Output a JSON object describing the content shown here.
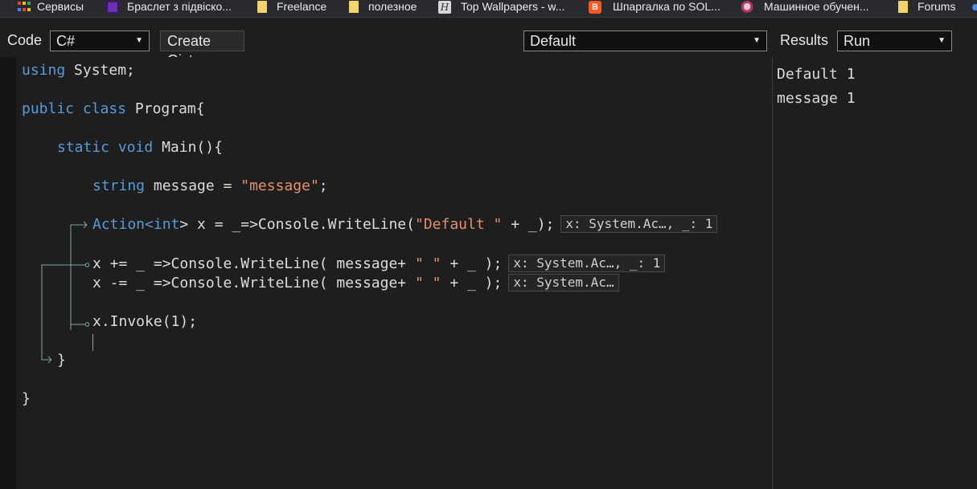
{
  "bookmarks": [
    {
      "label": "Сервисы",
      "icon": "apps-grid-icon"
    },
    {
      "label": "Браслет з підвіско...",
      "icon": "purple-square-icon"
    },
    {
      "label": "Freelance",
      "icon": "folder-icon"
    },
    {
      "label": "полезное",
      "icon": "folder-icon"
    },
    {
      "label": "Top Wallpapers - w...",
      "icon": "script-h-icon"
    },
    {
      "label": "Шпаргалка по SOL...",
      "icon": "blogger-icon"
    },
    {
      "label": "Машинное обучен...",
      "icon": "avatar-icon"
    },
    {
      "label": "Forums",
      "icon": "folder-icon"
    }
  ],
  "toolbar": {
    "code_label": "Code",
    "language_value": "C#",
    "create_gist_label": "Create Gist",
    "mode_value": "Default",
    "results_label": "Results",
    "run_value": "Run"
  },
  "code": {
    "l1_kw": "using",
    "l1_rest": " System;",
    "l2_kw1": "public",
    "l2_kw2": "class",
    "l2_rest": " Program{",
    "l3_kw1": "static",
    "l3_kw2": "void",
    "l3_rest": " Main(){",
    "l4_kw": "string",
    "l4_mid": " message = ",
    "l4_str": "\"message\"",
    "l4_end": ";",
    "l5_type": "Action<",
    "l5_kw": "int",
    "l5_mid": "> x = _=>Console.WriteLine(",
    "l5_str": "\"Default \"",
    "l5_end": " + _);",
    "l5_hint": "x: System.Ac…, _: 1",
    "l6_a": "x += _ =>Console.WriteLine( message+ ",
    "l6_str": "\" \"",
    "l6_b": " + _ );",
    "l6_hint": "x: System.Ac…, _: 1",
    "l7_a": "x -= _ =>Console.WriteLine( message+ ",
    "l7_str": "\" \"",
    "l7_b": " + _ );",
    "l7_hint": "x: System.Ac…",
    "l8": "x.Invoke(1);",
    "l9": "}",
    "l10": "}"
  },
  "results": {
    "lines": [
      "Default 1",
      "message 1"
    ]
  },
  "colors": {
    "keyword": "#569cd6",
    "string": "#e4906a",
    "text": "#dcdcdc",
    "background": "#1e1e1e",
    "arrow": "#7aa7a0"
  }
}
